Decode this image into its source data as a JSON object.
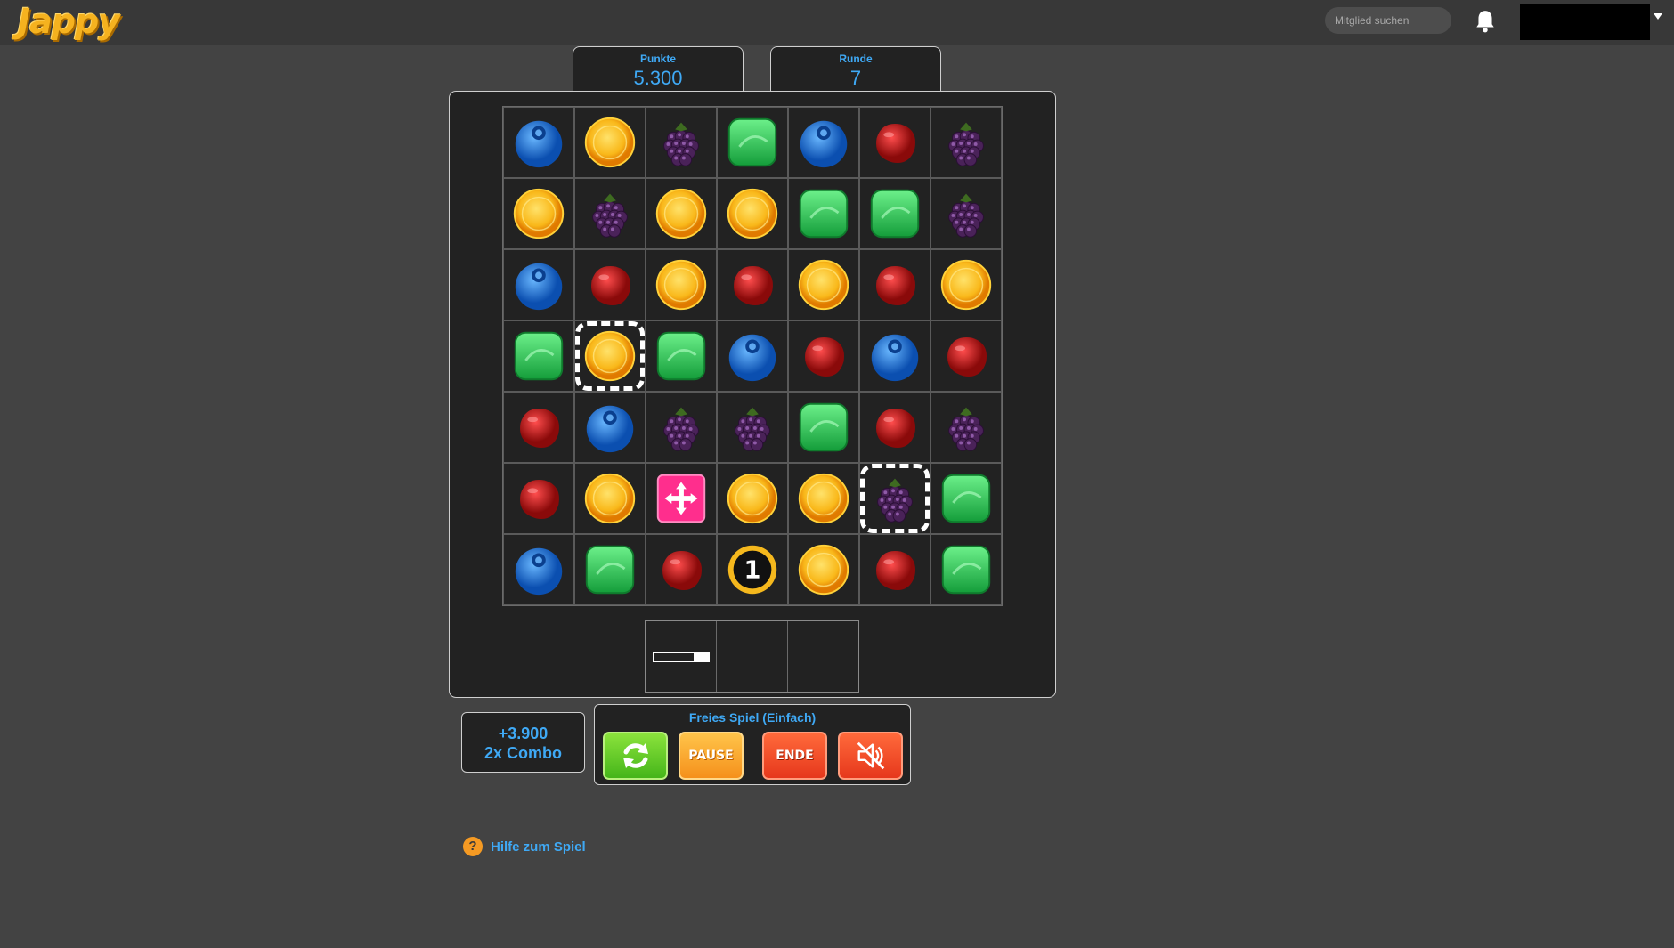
{
  "header": {
    "logo_text": "Jappy",
    "search_placeholder": "Mitglied suchen"
  },
  "score": {
    "label": "Punkte",
    "value": "5.300"
  },
  "round": {
    "label": "Runde",
    "value": "7"
  },
  "board": {
    "rows": [
      [
        "blueberry",
        "orange",
        "blackberry",
        "lime",
        "blueberry",
        "cherry",
        "blackberry"
      ],
      [
        "orange",
        "blackberry",
        "orange",
        "orange",
        "lime",
        "lime",
        "blackberry"
      ],
      [
        "blueberry",
        "cherry",
        "orange",
        "cherry",
        "orange",
        "cherry",
        "orange"
      ],
      [
        "lime",
        "orange",
        "lime",
        "blueberry",
        "cherry",
        "blueberry",
        "cherry"
      ],
      [
        "cherry",
        "blueberry",
        "blackberry",
        "blackberry",
        "lime",
        "cherry",
        "blackberry"
      ],
      [
        "cherry",
        "orange",
        "pink-cross-bonus",
        "orange",
        "orange",
        "blackberry",
        "lime"
      ],
      [
        "blueberry",
        "lime",
        "cherry",
        "number-coin",
        "orange",
        "cherry",
        "lime"
      ]
    ],
    "coin_number": "1",
    "selected_cells": [
      [
        3,
        1
      ],
      [
        5,
        5
      ]
    ]
  },
  "slots": {
    "progress_fraction": 0.28
  },
  "combo": {
    "points": "+3.900",
    "text": "2x Combo"
  },
  "controls": {
    "title": "Freies Spiel (Einfach)",
    "pause_label": "PAUSE",
    "end_label": "ENDE"
  },
  "help": {
    "icon_text": "?",
    "label": "Hilfe zum Spiel"
  },
  "colors": {
    "background": "#434343",
    "accent_blue": "#3fa9f5",
    "panel": "#222222"
  }
}
